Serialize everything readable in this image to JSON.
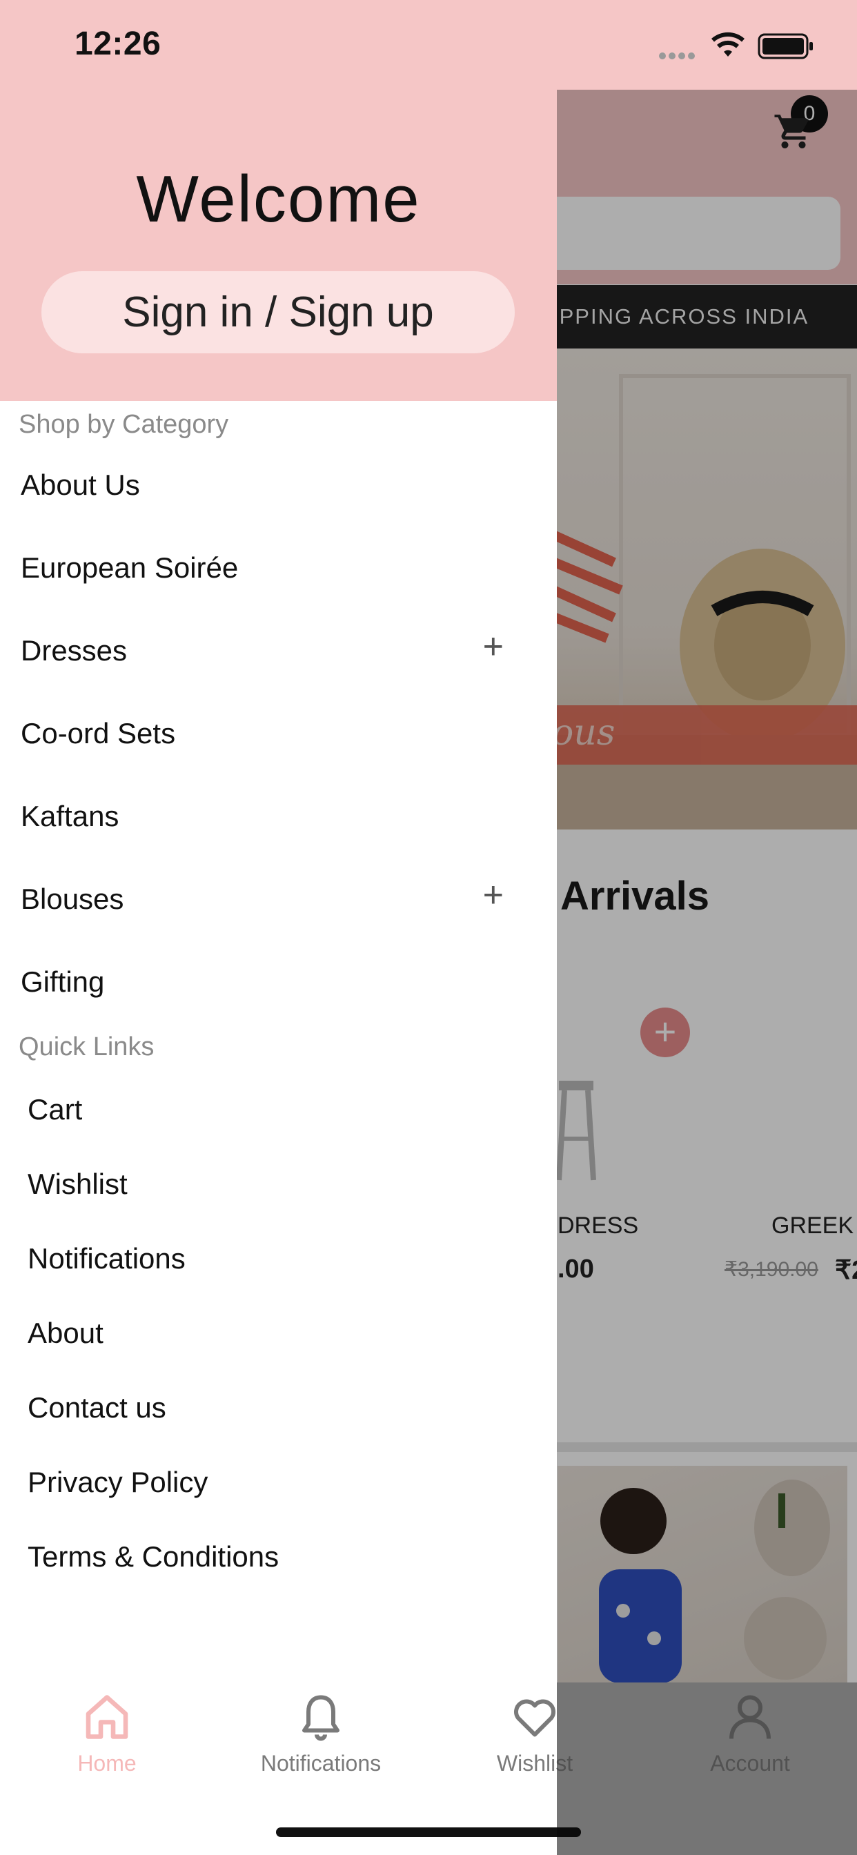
{
  "status_bar": {
    "time": "12:26"
  },
  "drawer": {
    "welcome": "Welcome",
    "signin_label": "Sign in / Sign up",
    "shop_by_category_title": "Shop by Category",
    "categories": [
      {
        "label": "About Us",
        "expandable": false
      },
      {
        "label": "European Soirée",
        "expandable": false
      },
      {
        "label": "Dresses",
        "expandable": true
      },
      {
        "label": "Co-ord Sets",
        "expandable": false
      },
      {
        "label": "Kaftans",
        "expandable": false
      },
      {
        "label": "Blouses",
        "expandable": true
      },
      {
        "label": "Gifting",
        "expandable": false
      }
    ],
    "quick_links_title": "Quick Links",
    "quick_links": [
      "Cart",
      "Wishlist",
      "Notifications",
      "About",
      "Contact us",
      "Privacy Policy",
      "Terms & Conditions"
    ],
    "plus_glyph": "+"
  },
  "background": {
    "cart_count": "0",
    "shipping_banner": "IPPING ACROSS INDIA",
    "section_heading": "Arrivals",
    "product_1_name": "DRESS",
    "product_1_price": ".00",
    "product_2_name": "GREEK",
    "product_2_old_price": "₹3,190.00",
    "product_2_price": "₹2",
    "hero_script": "ous"
  },
  "tabbar": {
    "tabs": [
      {
        "label": "Home",
        "icon": "home-icon",
        "active": true
      },
      {
        "label": "Notifications",
        "icon": "bell-icon",
        "active": false
      },
      {
        "label": "Wishlist",
        "icon": "heart-icon",
        "active": false
      },
      {
        "label": "Account",
        "icon": "person-icon",
        "active": false
      }
    ],
    "active_color": "#f5b8b8",
    "inactive_color": "#7a7a7a"
  },
  "colors": {
    "header_pink": "#f5c6c6",
    "signin_pill": "#fbe2e2",
    "shipping_bar": "#232323"
  }
}
